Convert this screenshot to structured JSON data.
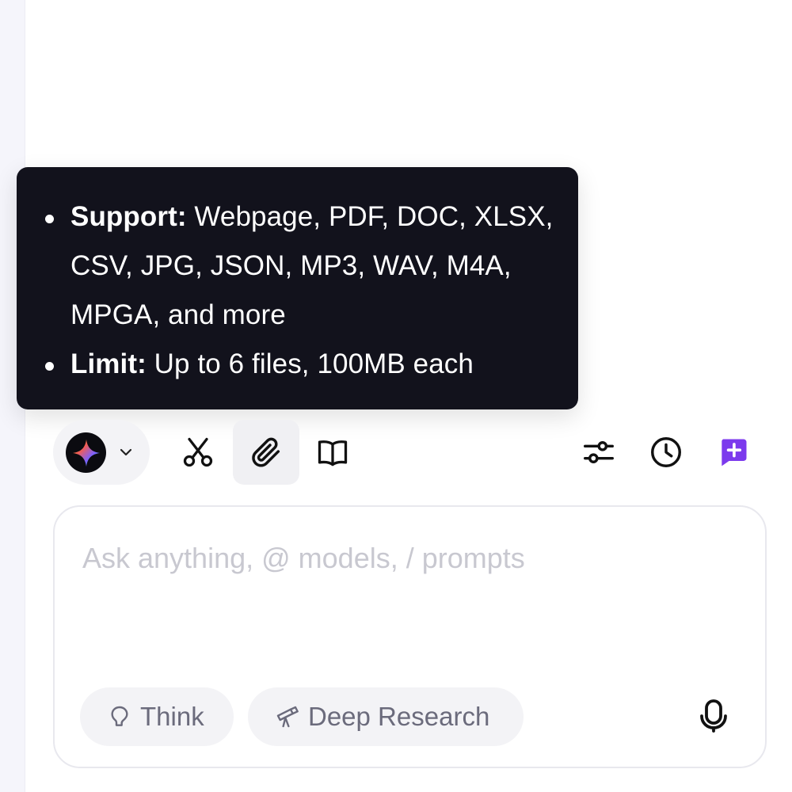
{
  "tooltip": {
    "items": [
      {
        "label": "Support:",
        "text": " Webpage, PDF, DOC, XLSX, CSV, JPG, JSON, MP3, WAV, M4A, MPGA, and more"
      },
      {
        "label": "Limit:",
        "text": " Up to 6 files, 100MB each"
      }
    ]
  },
  "toolbar": {
    "model_icon": "gradient-sparkle-icon",
    "tools": [
      "scissors-icon",
      "paperclip-icon",
      "book-icon"
    ],
    "right_tools": [
      "sliders-icon",
      "clock-icon",
      "new-chat-icon"
    ]
  },
  "input": {
    "placeholder": "Ask anything, @ models, / prompts",
    "value": ""
  },
  "buttons": {
    "think": "Think",
    "deep_research": "Deep Research"
  },
  "colors": {
    "tooltip_bg": "#12121c",
    "accent": "#7c3aed",
    "pill_bg": "#f3f3f6",
    "pill_text": "#6b6b7c",
    "placeholder": "#c8c8d0"
  }
}
